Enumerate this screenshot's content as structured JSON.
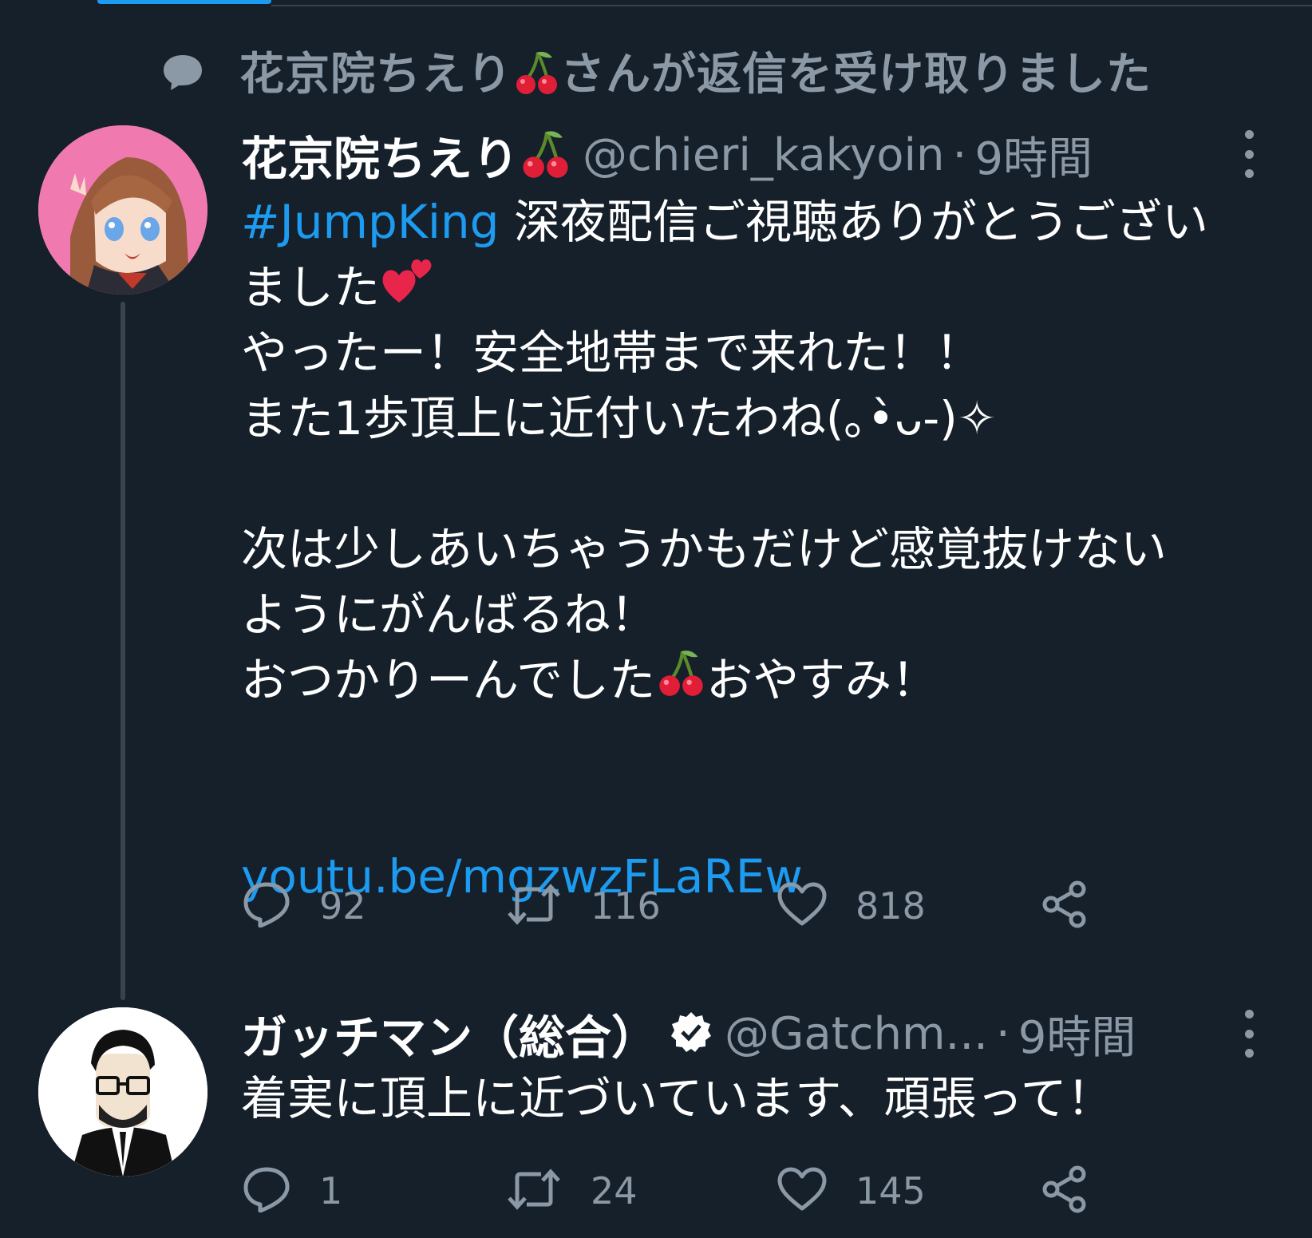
{
  "context": {
    "text_before": "花京院ちえり",
    "text_after": "さんが返信を受け取りました"
  },
  "tweets": [
    {
      "display_name": "花京院ちえり",
      "handle": "@chieri_kakyoin",
      "separator": "·",
      "time": "9時間",
      "hashtag": "#JumpKing",
      "line1_rest": " 深夜配信ご視聴ありがとうござい",
      "line2": "ました",
      "line3": "やったー！安全地帯まで来れた！！",
      "line4": "また1歩頂上に近付いたわね(｡•̀ᴗ-)✧",
      "line5": "次は少しあいちゃうかもだけど感覚抜けない",
      "line6": "ようにがんばるね！",
      "line7_before": "おつかりーんでした",
      "line7_after": "おやすみ！",
      "link": "youtu.be/mgzwzFLaREw",
      "stats": {
        "replies": "92",
        "retweets": "116",
        "likes": "818"
      }
    },
    {
      "display_name": "ガッチマン（総合）",
      "handle": "@Gatchm...",
      "separator": "·",
      "time": "9時間",
      "text": "着実に頂上に近づいています、頑張って！",
      "stats": {
        "replies": "1",
        "retweets": "24",
        "likes": "145"
      }
    }
  ],
  "icons": [
    "speech-bubble-icon",
    "cherry-icon",
    "heart-emoji-icon",
    "verified-badge-icon",
    "more-icon",
    "reply-icon",
    "retweet-icon",
    "like-icon",
    "share-icon"
  ],
  "colors": {
    "background": "#15202b",
    "secondary_text": "#8b98a5",
    "link": "#1d9bf0",
    "divider": "#38444d"
  }
}
